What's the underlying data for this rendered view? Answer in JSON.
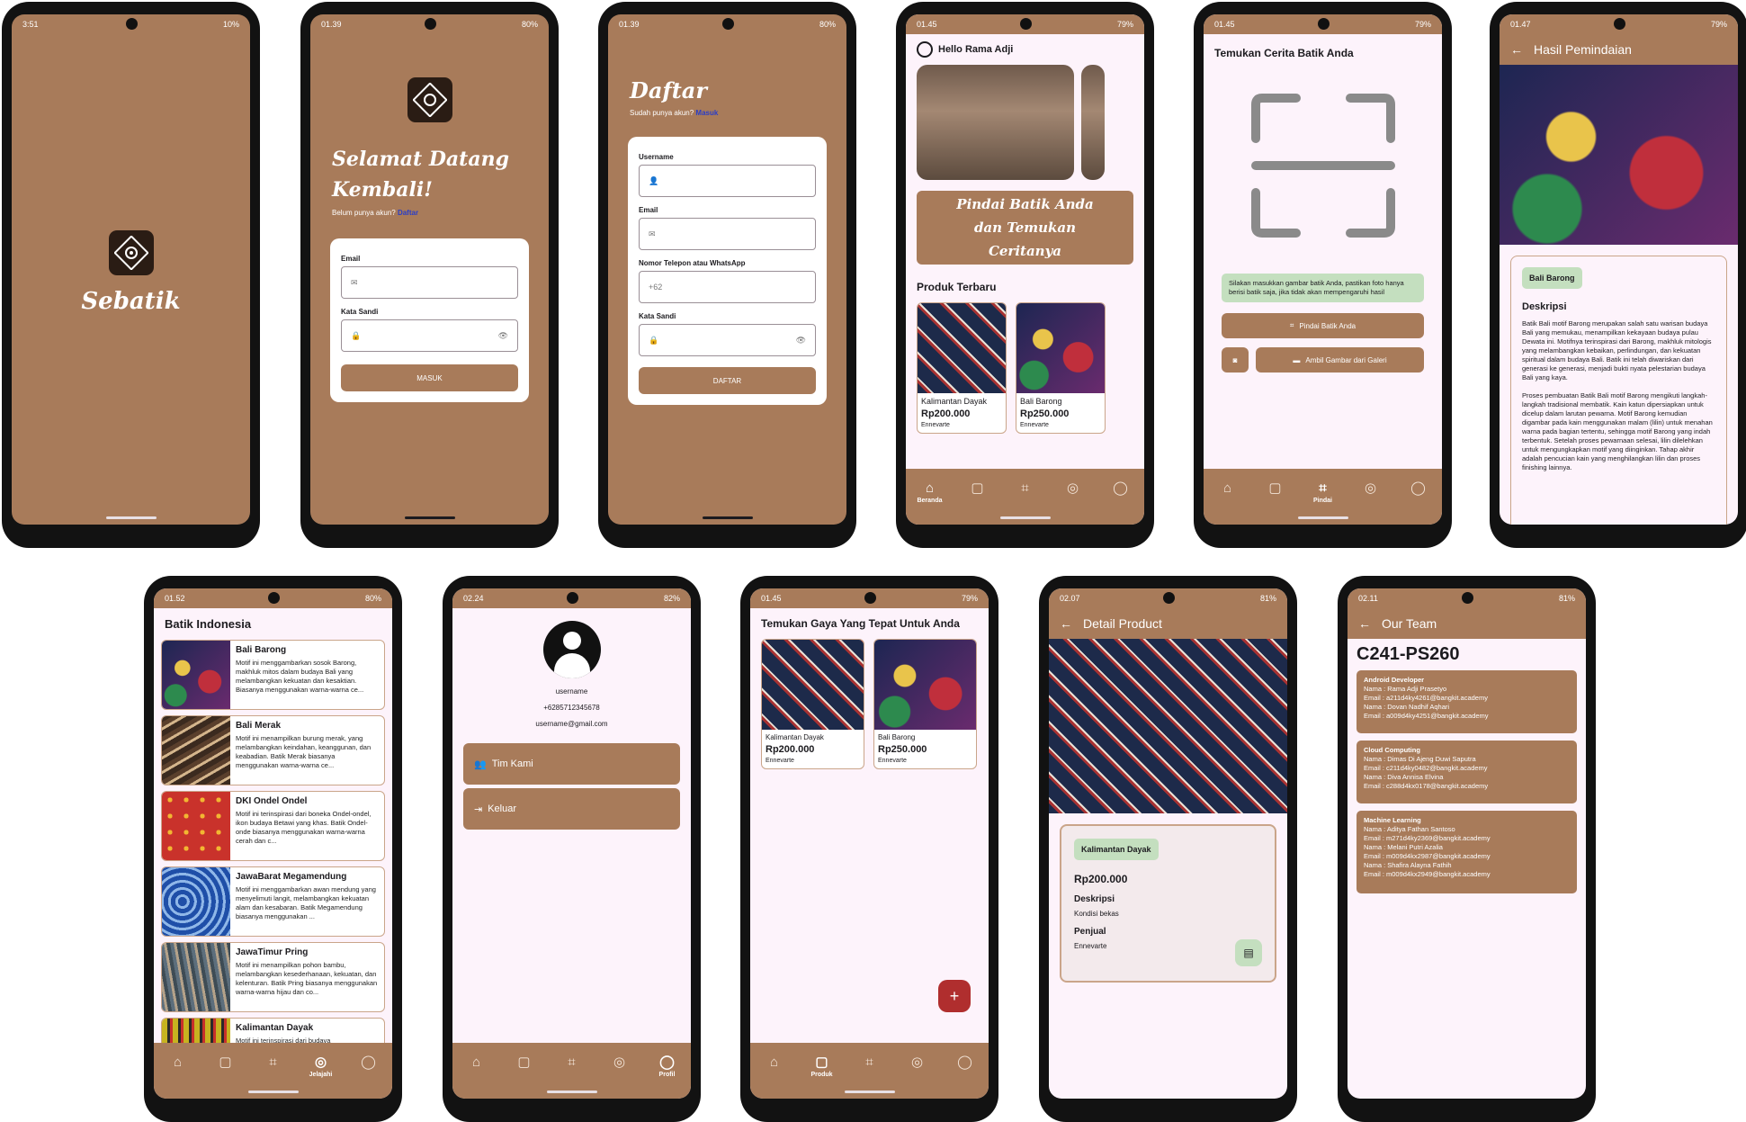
{
  "s1": {
    "time": "3:51",
    "status": "10%",
    "app_name": "Sebatik"
  },
  "s2": {
    "time": "01.39",
    "status": "80%",
    "title": "Selamat Datang Kembali!",
    "no_account": "Belum punya akun?",
    "register_link": "Daftar",
    "email_label": "Email",
    "password_label": "Kata Sandi",
    "login_button": "MASUK"
  },
  "s3": {
    "time": "01.39",
    "status": "80%",
    "title": "Daftar",
    "have_account": "Sudah punya akun?",
    "login_link": "Masuk",
    "username_label": "Username",
    "email_label": "Email",
    "phone_label": "Nomor Telepon atau WhatsApp",
    "phone_placeholder": "+62",
    "password_label": "Kata Sandi",
    "register_button": "DAFTAR"
  },
  "s4": {
    "time": "01.45",
    "status": "79%",
    "greeting": "Hello Rama Adji",
    "banner": "Pindai Batik Anda dan Temukan Ceritanya",
    "section": "Produk Terbaru",
    "products": [
      {
        "name": "Kalimantan Dayak",
        "price": "Rp200.000",
        "seller": "Ennevarte"
      },
      {
        "name": "Bali Barong",
        "price": "Rp250.000",
        "seller": "Ennevarte"
      }
    ],
    "nav_active": "Beranda"
  },
  "s5": {
    "time": "01.45",
    "status": "79%",
    "title": "Temukan Cerita Batik Anda",
    "hint": "Silakan masukkan gambar batik Anda, pastikan foto hanya berisi batik saja, jika tidak akan mempengaruhi hasil",
    "scan_button": "Pindai Batik Anda",
    "gallery_button": "Ambil Gambar dari Galeri",
    "nav_active": "Pindai"
  },
  "s6": {
    "time": "01.47",
    "status": "79%",
    "title": "Hasil Pemindaian",
    "tag": "Bali Barong",
    "desc_title": "Deskripsi",
    "desc1": "Batik Bali motif Barong merupakan salah satu warisan budaya Bali yang memukau, menampilkan kekayaan budaya pulau Dewata ini. Motifnya terinspirasi dari Barong, makhluk mitologis yang melambangkan kebaikan, perlindungan, dan kekuatan spiritual dalam budaya Bali. Batik ini telah diwariskan dari generasi ke generasi, menjadi bukti nyata pelestarian budaya Bali yang kaya.",
    "desc2": "Proses pembuatan Batik Bali motif Barong mengikuti langkah-langkah tradisional membatik. Kain katun dipersiapkan untuk dicelup dalam larutan pewarna. Motif Barong kemudian digambar pada kain menggunakan malam (lilin) untuk menahan warna pada bagian tertentu, sehingga motif Barong yang indah terbentuk. Setelah proses pewarnaan selesai, lilin dilelehkan untuk mengungkapkan motif yang diinginkan. Tahap akhir adalah pencucian kain yang menghilangkan lilin dan proses finishing lainnya."
  },
  "s7": {
    "time": "01.52",
    "status": "80%",
    "title": "Batik Indonesia",
    "items": [
      {
        "name": "Bali Barong",
        "desc": "Motif ini menggambarkan sosok Barong, makhluk mitos dalam budaya Bali yang melambangkan kekuatan dan kesaktian. Biasanya menggunakan warna-warna ce..."
      },
      {
        "name": "Bali Merak",
        "desc": "Motif ini menampilkan burung merak, yang melambangkan keindahan, keanggunan, dan keabadian. Batik Merak biasanya menggunakan warna-warna ce..."
      },
      {
        "name": "DKI Ondel Ondel",
        "desc": "Motif ini terinspirasi dari boneka Ondel-ondel, ikon budaya Betawi yang khas. Batik Ondel-onde biasanya menggunakan warna-warna cerah dan c..."
      },
      {
        "name": "JawaBarat Megamendung",
        "desc": "Motif ini menggambarkan awan mendung yang menyelimuti langit, melambangkan kekuatan alam dan kesabaran. Batik Megamendung biasanya menggunakan ..."
      },
      {
        "name": "JawaTimur Pring",
        "desc": "Motif ini menampilkan pohon bambu, melambangkan kesederhanaan, kekuatan, dan kelenturan. Batik Pring biasanya menggunakan warna-warna hijau dan co..."
      },
      {
        "name": "Kalimantan Dayak",
        "desc": "Motif ini terinspirasi dari budaya"
      }
    ],
    "nav_active": "Jelajahi"
  },
  "s8": {
    "time": "02.24",
    "status": "82%",
    "username": "username",
    "phone": "+6285712345678",
    "email": "username@gmail.com",
    "team_button": "Tim Kami",
    "logout_button": "Keluar",
    "nav_active": "Profil"
  },
  "s9": {
    "time": "01.45",
    "status": "79%",
    "title": "Temukan Gaya Yang Tepat Untuk Anda",
    "products": [
      {
        "name": "Kalimantan Dayak",
        "price": "Rp200.000",
        "seller": "Ennevarte"
      },
      {
        "name": "Bali Barong",
        "price": "Rp250.000",
        "seller": "Ennevarte"
      }
    ],
    "nav_active": "Produk"
  },
  "s10": {
    "time": "02.07",
    "status": "81%",
    "title": "Detail Product",
    "tag": "Kalimantan Dayak",
    "price": "Rp200.000",
    "desc_title": "Deskripsi",
    "desc": "Kondisi bekas",
    "seller_title": "Penjual",
    "seller": "Ennevarte"
  },
  "s11": {
    "time": "02.11",
    "status": "81%",
    "title": "Our Team",
    "team_id": "C241-PS260",
    "groups": [
      {
        "role": "Android Developer",
        "lines": [
          "Nama : Rama Adji Prasetyo",
          "Email : a211d4ky4261@bangkit.academy",
          "Nama : Dovan Nadhif Aqhari",
          "Email : a009d4ky4251@bangkit.academy"
        ]
      },
      {
        "role": "Cloud Computing",
        "lines": [
          "Nama : Dimas Di Ajeng Duwi Saputra",
          "Email : c211d4ky0482@bangkit.academy",
          "Nama : Diva Annisa Elvina",
          "Email : c288d4kx0178@bangkit.academy"
        ]
      },
      {
        "role": "Machine Learning",
        "lines": [
          "Nama : Aditya Fathan Santoso",
          "Email : m271d4ky2369@bangkit.academy",
          "Nama : Melani Putri Azalia",
          "Email : m009d4kx2987@bangkit.academy",
          "Nama : Shafira Alayna Fathih",
          "Email : m009d4kx2949@bangkit.academy"
        ]
      }
    ]
  },
  "nav": {
    "home": "Beranda",
    "shop": "Produk",
    "scan": "Pindai",
    "explore": "Jelajahi",
    "profile": "Profil"
  },
  "colors": {
    "brand": "#a87b5a",
    "background": "#fdf3fb",
    "tag_green": "#c4dfbf"
  }
}
